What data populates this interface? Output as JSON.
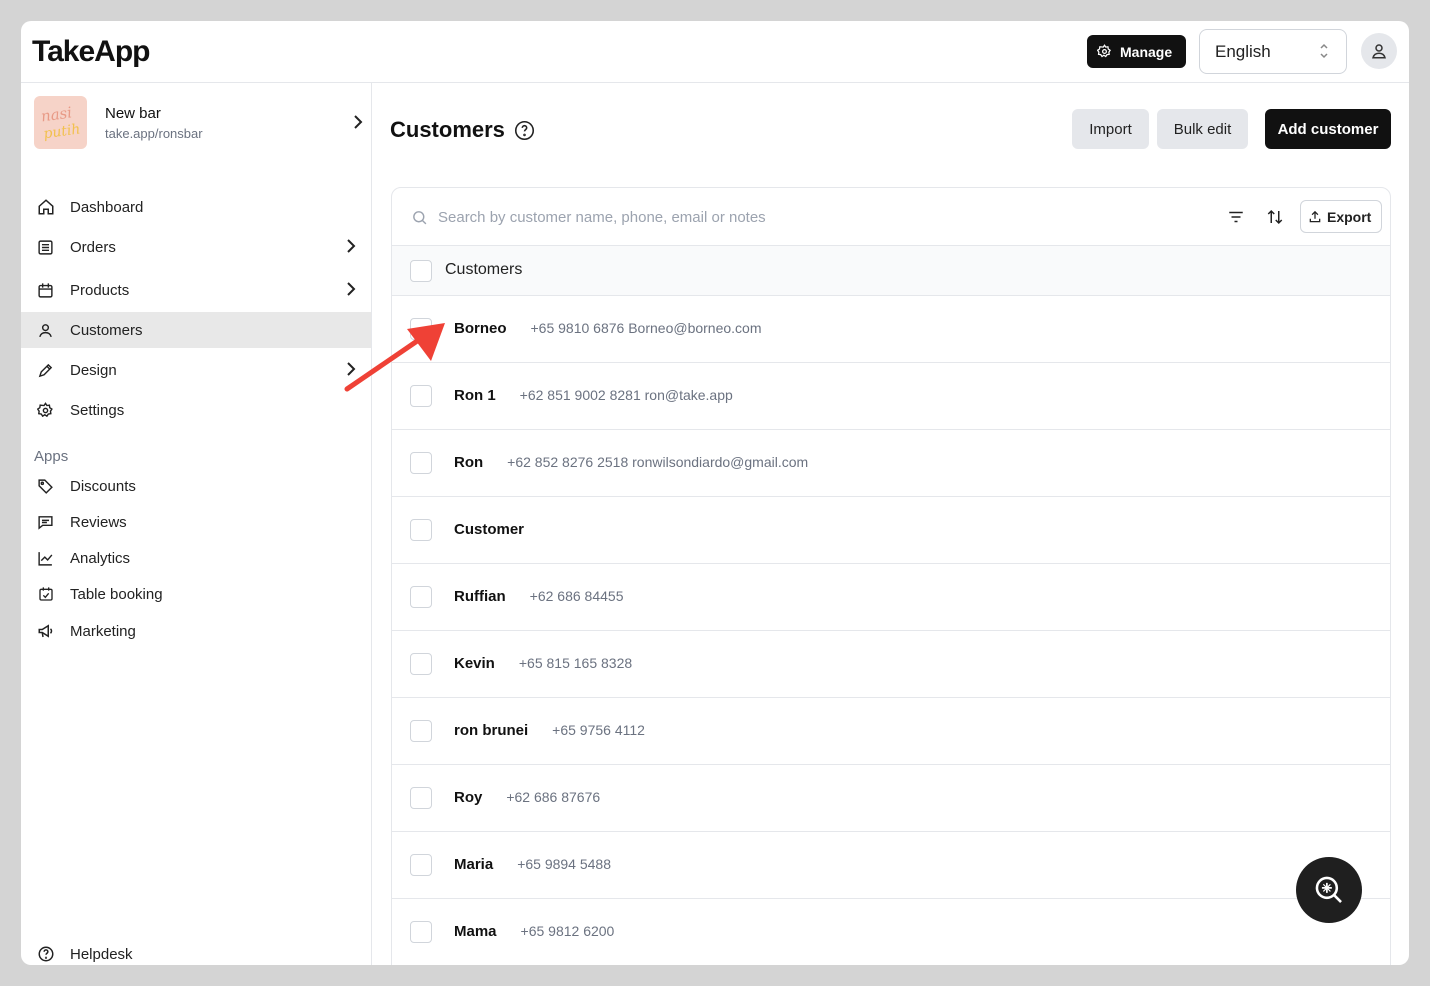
{
  "app": {
    "logo": "TakeApp"
  },
  "topbar": {
    "manage_label": "Manage",
    "language": "English"
  },
  "store": {
    "name": "New bar",
    "url": "take.app/ronsbar",
    "logo_text": "nasi\nputih"
  },
  "nav": [
    {
      "label": "Dashboard",
      "icon": "home-icon",
      "chevron": false
    },
    {
      "label": "Orders",
      "icon": "orders-icon",
      "chevron": true
    },
    {
      "label": "Products",
      "icon": "box-icon",
      "chevron": true
    },
    {
      "label": "Customers",
      "icon": "user-icon",
      "chevron": false,
      "active": true
    },
    {
      "label": "Design",
      "icon": "pen-icon",
      "chevron": true
    },
    {
      "label": "Settings",
      "icon": "gear-icon",
      "chevron": false
    }
  ],
  "apps": {
    "label": "Apps",
    "items": [
      {
        "label": "Discounts",
        "icon": "tag-icon"
      },
      {
        "label": "Reviews",
        "icon": "review-icon"
      },
      {
        "label": "Analytics",
        "icon": "chart-icon"
      },
      {
        "label": "Table booking",
        "icon": "calendar-icon"
      },
      {
        "label": "Marketing",
        "icon": "megaphone-icon"
      }
    ]
  },
  "helpdesk": {
    "label": "Helpdesk",
    "icon": "help-icon"
  },
  "page": {
    "title": "Customers",
    "import_label": "Import",
    "bulk_edit_label": "Bulk edit",
    "add_label": "Add customer"
  },
  "table": {
    "search_placeholder": "Search by customer name, phone, email or notes",
    "export_label": "Export",
    "header": "Customers",
    "rows": [
      {
        "name": "Borneo",
        "meta": "+65 9810 6876 Borneo@borneo.com"
      },
      {
        "name": "Ron 1",
        "meta": "+62 851 9002 8281 ron@take.app"
      },
      {
        "name": "Ron",
        "meta": "+62 852 8276 2518 ronwilsondiardo@gmail.com"
      },
      {
        "name": "Customer",
        "meta": ""
      },
      {
        "name": "Ruffian",
        "meta": "+62 686 84455"
      },
      {
        "name": "Kevin",
        "meta": "+65 815 165 8328"
      },
      {
        "name": "ron brunei",
        "meta": "+65 9756 4112"
      },
      {
        "name": "Roy",
        "meta": "+62 686 87676"
      },
      {
        "name": "Maria",
        "meta": "+65 9894 5488"
      },
      {
        "name": "Mama",
        "meta": "+65 9812 6200"
      }
    ]
  },
  "colors": {
    "accent": "#111111",
    "annotation_arrow": "#ef4136",
    "active_nav": "#e8e8e8"
  }
}
